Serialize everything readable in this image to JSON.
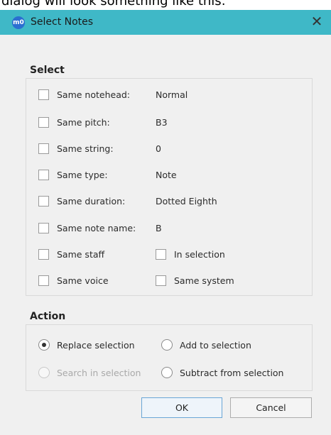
{
  "caption": "dialog will look something like this:",
  "window": {
    "title": "Select Notes",
    "icon_text": "m0",
    "close_glyph": "✕"
  },
  "select_group": {
    "title": "Select",
    "rows": [
      {
        "label": "Same notehead:",
        "value": "Normal",
        "checked": false
      },
      {
        "label": "Same pitch:",
        "value": "B3",
        "checked": false
      },
      {
        "label": "Same string:",
        "value": "0",
        "checked": false
      },
      {
        "label": "Same type:",
        "value": "Note",
        "checked": false
      },
      {
        "label": "Same duration:",
        "value": "Dotted Eighth",
        "checked": false
      },
      {
        "label": "Same note name:",
        "value": "B",
        "checked": false
      }
    ],
    "pairs": [
      {
        "left": "Same staff",
        "right": "In selection"
      },
      {
        "left": "Same voice",
        "right": "Same system"
      }
    ]
  },
  "action_group": {
    "title": "Action",
    "options": {
      "replace": "Replace selection",
      "add": "Add to selection",
      "search": "Search in selection",
      "subtract": "Subtract from selection"
    },
    "selected": "replace"
  },
  "buttons": {
    "ok": "OK",
    "cancel": "Cancel"
  }
}
